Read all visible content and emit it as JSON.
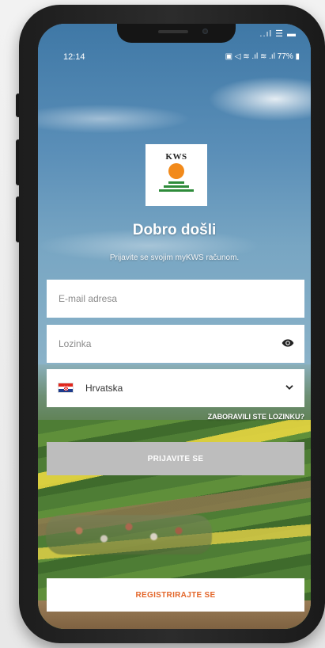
{
  "status_bar": {
    "time": "12:14",
    "ios_right": "..ıl ☰ ▬",
    "android_right": "▣ ◁ ≋ .ıl ≋ .ıl 77% ▮"
  },
  "logo": {
    "text": "KWS"
  },
  "login": {
    "title": "Dobro došli",
    "subtitle": "Prijavite se svojim myKWS računom.",
    "email_placeholder": "E-mail adresa",
    "password_placeholder": "Lozinka",
    "country_selected": "Hrvatska",
    "forgot_label": "ZABORAVILI STE LOZINKU?",
    "login_label": "PRIJAVITE SE",
    "register_label": "REGISTRIRAJTE SE"
  },
  "colors": {
    "brand_orange": "#e3672b",
    "logo_orange": "#f28a1b",
    "logo_green": "#2e8b3a",
    "disabled_button": "#bdbdbd"
  }
}
